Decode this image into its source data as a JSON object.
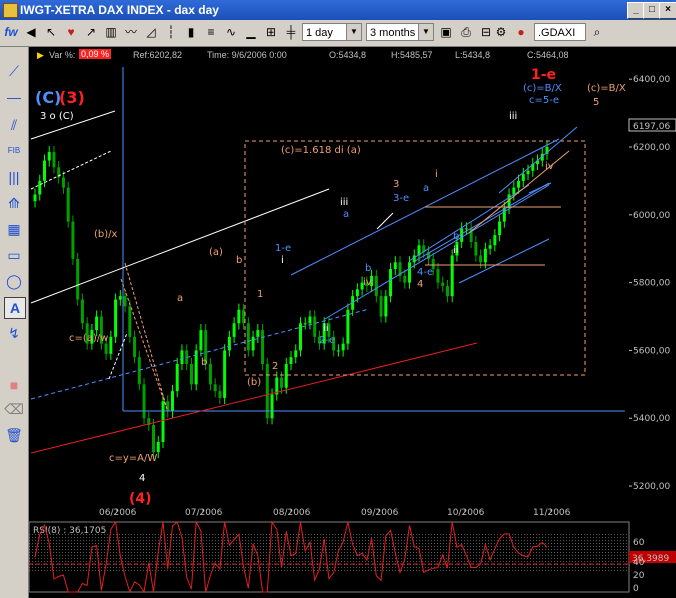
{
  "window": {
    "title": "IWGT-XETRA DAX INDEX  -  dax day"
  },
  "toolbar": {
    "interval": "1 day",
    "range": "3 months",
    "symbol": ".GDAXI",
    "fw_label": "fw"
  },
  "infobar": {
    "var_label": "Var %:",
    "var_value": "0,09 %",
    "ref_label": "Ref:6202,82",
    "time_label": "Time: 9/6/2006 0:00",
    "open_label": "O:5434,8",
    "high_label": "H:5485,57",
    "low_label": "L:5434,8",
    "close_label": "C:5464,08"
  },
  "colors": {
    "up": "#00ff00",
    "down": "#00a000",
    "wave_orange": "#f0a070",
    "wave_blue": "#4f8fff",
    "wave_red": "#ff2020",
    "box": "#f0a070"
  },
  "chart_data": {
    "type": "candlestick",
    "ylim": [
      5150,
      6430
    ],
    "yticks": [
      "6400,00",
      "6200,00",
      "6000,00",
      "5800,00",
      "5600,00",
      "5400,00",
      "5200,00"
    ],
    "ytick_values": [
      6400,
      6200,
      6000,
      5800,
      5600,
      5400,
      5200
    ],
    "xticks": [
      "06/2006",
      "07/2006",
      "08/2006",
      "09/2006",
      "10/2006",
      "11/2006"
    ],
    "last_price_label": "6197,06",
    "close": [
      6060,
      6100,
      6160,
      6185,
      6140,
      6110,
      6080,
      5980,
      5870,
      5750,
      5680,
      5620,
      5660,
      5700,
      5620,
      5590,
      5640,
      5750,
      5760,
      5730,
      5640,
      5580,
      5500,
      5400,
      5380,
      5300,
      5330,
      5450,
      5420,
      5480,
      5560,
      5600,
      5560,
      5500,
      5600,
      5660,
      5560,
      5500,
      5480,
      5460,
      5600,
      5640,
      5680,
      5720,
      5680,
      5600,
      5640,
      5660,
      5560,
      5400,
      5470,
      5520,
      5490,
      5560,
      5580,
      5600,
      5680,
      5680,
      5700,
      5640,
      5620,
      5680,
      5640,
      5600,
      5600,
      5620,
      5720,
      5760,
      5780,
      5800,
      5790,
      5820,
      5760,
      5700,
      5760,
      5840,
      5860,
      5820,
      5800,
      5860,
      5880,
      5910,
      5890,
      5870,
      5840,
      5800,
      5790,
      5760,
      5880,
      5920,
      5960,
      5960,
      5920,
      5880,
      5860,
      5900,
      5910,
      5940,
      5980,
      6020,
      6060,
      6080,
      6100,
      6120,
      6130,
      6150,
      6160,
      6180,
      6200
    ],
    "waves": {
      "C": "(C)",
      "three": "(3)",
      "three_o_c": "3 o (C)",
      "b_x": "(b)/x",
      "c_aw": "c=(a)/w",
      "cya": "c=y=A/W",
      "four": "4",
      "four_paren": "(4)",
      "a1": "a",
      "b1": "b",
      "a_paren": "(a)",
      "b_lower": "b",
      "one": "1",
      "b_paren": "(b)",
      "two": "2",
      "fib_box": "(c)=1.618 di (a)",
      "one_e": "1-e",
      "i1": "i",
      "ii1": "ii",
      "two_e": "2-e",
      "iii1": "iii",
      "a2": "a",
      "b2": "b",
      "iv1": "iv",
      "three_big": "3",
      "three_e": "3-e",
      "a3": "a",
      "i3": "i",
      "b3": "b",
      "ii3": "ii",
      "four_e": "4-e",
      "four_b": "4",
      "iii_top": "iii",
      "iv_top": "iv",
      "one_e_red": "1-e",
      "c_bx": "(c)=B/X",
      "c5e": "c=5-e",
      "c_bx2": "(c)=B/X",
      "five": "5"
    }
  },
  "rsi": {
    "label": "RSI(8) : 36,1705",
    "value_box": "36,3989",
    "ticks": [
      "60",
      "40",
      "20",
      "0"
    ]
  }
}
